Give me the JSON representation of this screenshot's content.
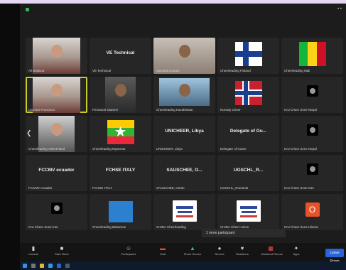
{
  "window": {
    "right_text": "• •"
  },
  "colors": {
    "selected_outline": "#c8cc2a",
    "leave_button": "#2a63d8",
    "tile_bg": "#262626"
  },
  "tiles": [
    {
      "id": "r1c1",
      "type": "video",
      "name": "Ali Baltazar"
    },
    {
      "id": "r1c2",
      "type": "text",
      "center": "VE Technical",
      "name": "VE Technical"
    },
    {
      "id": "r1c3",
      "type": "video",
      "name": "Manisha Kumari"
    },
    {
      "id": "r1c4",
      "type": "flag",
      "flag": "finland",
      "name": "Cheerleading Finland"
    },
    {
      "id": "r1c5",
      "type": "flag",
      "flag": "mali",
      "name": "Cheerleading Mali"
    },
    {
      "id": "r2c1",
      "type": "video",
      "selected": true,
      "name": "Leonard Francisco"
    },
    {
      "id": "r2c2",
      "type": "video",
      "name": "Fernando Gianesi"
    },
    {
      "id": "r2c3",
      "type": "video",
      "name": "Cheerleading Kazakhstan"
    },
    {
      "id": "r2c4",
      "type": "flag",
      "flag": "norway",
      "name": "Norway Cheer"
    },
    {
      "id": "r2c5",
      "type": "avatar",
      "name": "ICU Cheer Zone Nepal"
    },
    {
      "id": "r3c1",
      "type": "video",
      "name": "Cheerleading Switzerland"
    },
    {
      "id": "r3c2",
      "type": "flag",
      "flag": "myanmar",
      "name": "Cheerleading Myanmar"
    },
    {
      "id": "r3c3",
      "type": "text",
      "center": "UNICHEER, Libya",
      "name": "UNICHEER, Libya"
    },
    {
      "id": "r3c4",
      "type": "text",
      "center": "Delegate of Gu...",
      "name": "Delegate of Guam"
    },
    {
      "id": "r3c5",
      "type": "avatar",
      "name": "ICU Cheer Zone Nepal"
    },
    {
      "id": "r4c1",
      "type": "text",
      "center": "FCCMV ecuador",
      "name": "FCCMV ecuador"
    },
    {
      "id": "r4c2",
      "type": "text",
      "center": "FCHSE ITALY",
      "name": "FCHSE ITALY"
    },
    {
      "id": "r4c3",
      "type": "text",
      "center": "SAUSCHEE, O...",
      "name": "SAUSCHEE, Oman"
    },
    {
      "id": "r4c4",
      "type": "text",
      "center": "UGSCHL_R...",
      "name": "UGSCHL_Romania"
    },
    {
      "id": "r4c5",
      "type": "avatar",
      "name": "ICU Cheer Zone Iran"
    },
    {
      "id": "r5c1",
      "type": "avatar",
      "name": "ICU Cheer Zone Iran"
    },
    {
      "id": "r5c2",
      "type": "blue",
      "name": "Cheerleading Bahamas"
    },
    {
      "id": "r5c3",
      "type": "logo",
      "name": "CHINA Cheerleading"
    },
    {
      "id": "r5c4",
      "type": "logo",
      "name": "CHINA Cheer Union"
    },
    {
      "id": "r5c5",
      "type": "initial",
      "initial": "O",
      "name": "ICU Cheer Zone Liberia"
    }
  ],
  "nav": {
    "left_arrow": "❮"
  },
  "participants_popup": "1 more participant",
  "toolbar": {
    "items": [
      {
        "icon": "mic-icon",
        "glyph": "▮",
        "label": "Unmute",
        "tone": ""
      },
      {
        "icon": "video-icon",
        "glyph": "■",
        "label": "Start Video",
        "tone": ""
      },
      {
        "icon": "participants-icon",
        "glyph": "☺",
        "label": "Participants",
        "tone": ""
      },
      {
        "icon": "chat-icon",
        "glyph": "▬",
        "label": "Chat",
        "tone": "red"
      },
      {
        "icon": "share-icon",
        "glyph": "▲",
        "label": "Share Screen",
        "tone": "green"
      },
      {
        "icon": "record-icon",
        "glyph": "●",
        "label": "Record",
        "tone": ""
      },
      {
        "icon": "reactions-icon",
        "glyph": "♥",
        "label": "Reactions",
        "tone": ""
      },
      {
        "icon": "breakout-icon",
        "glyph": "▦",
        "label": "Breakout Rooms",
        "tone": "red"
      },
      {
        "icon": "apps-icon",
        "glyph": "✦",
        "label": "Apps",
        "tone": ""
      }
    ],
    "leave": "Leave Room"
  }
}
